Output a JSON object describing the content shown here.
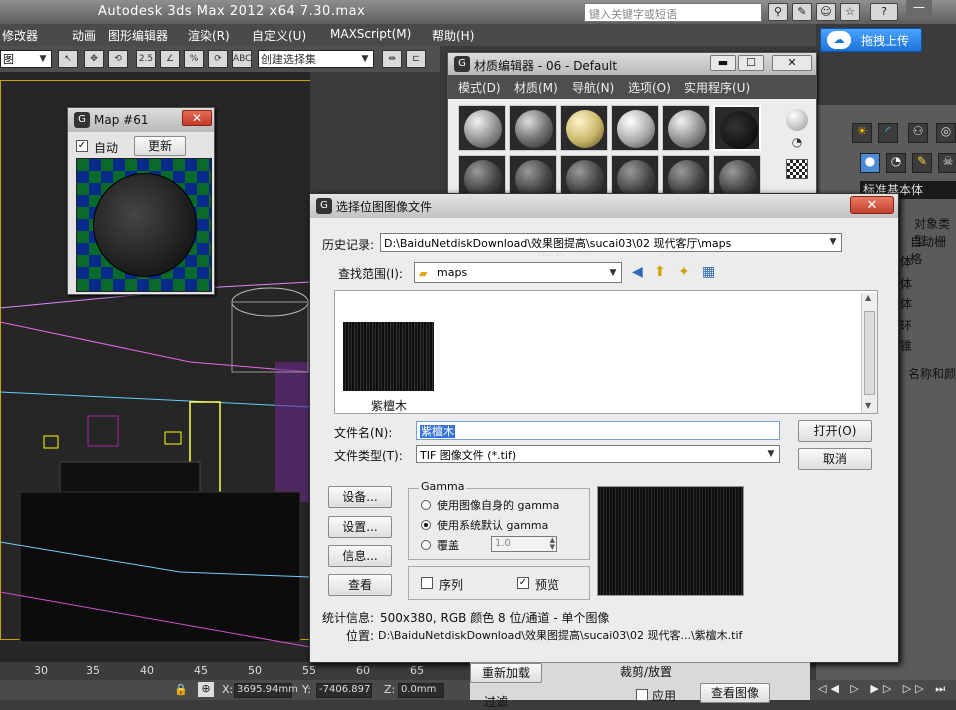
{
  "app": {
    "title": "Autodesk 3ds Max  2012 x64     7.30.max",
    "search_placeholder": "键入关键字或短语",
    "upload_label": "拖拽上传",
    "minimize": "—"
  },
  "menubar": {
    "items": [
      "修改器",
      "动画",
      "图形编辑器",
      "渲染(R)",
      "自定义(U)",
      "MAXScript(M)",
      "帮助(H)"
    ]
  },
  "toolbar": {
    "view_dropdown": "图",
    "selection_set": "创建选择集",
    "icons": [
      "↖",
      "✥",
      "⟲",
      "▣",
      "2.5",
      "∠",
      "%",
      "⟳",
      "ABC"
    ]
  },
  "map61": {
    "title": "Map #61",
    "auto_label": "自动",
    "auto_checked": true,
    "update_label": "更新",
    "close": "✕"
  },
  "material_editor": {
    "title": "材质编辑器 - 06 - Default",
    "menus": [
      "模式(D)",
      "材质(M)",
      "导航(N)",
      "选项(O)",
      "实用程序(U)"
    ],
    "min": "▬",
    "max": "☐",
    "close": "✕"
  },
  "dialog": {
    "title": "选择位图图像文件",
    "close": "✕",
    "history_label": "历史记录:",
    "history_value": "D:\\BaiduNetdiskDownload\\效果图提高\\sucai03\\02 现代客厅\\maps",
    "lookin_label": "查找范围(I):",
    "lookin_value": "maps",
    "files": [
      {
        "name": "紫檀木"
      }
    ],
    "filename_label": "文件名(N):",
    "filename_value": "紫檀木",
    "filetype_label": "文件类型(T):",
    "filetype_value": "TIF 图像文件 (*.tif)",
    "open_button": "打开(O)",
    "cancel_button": "取消",
    "setup_button": "设备...",
    "settings_button": "设置...",
    "info_button": "信息...",
    "view_button": "查看",
    "gamma": {
      "title": "Gamma",
      "opt1": "使用图像自身的 gamma",
      "opt2": "使用系统默认 gamma",
      "opt3": "覆盖",
      "override_value": "1.0",
      "selected": 2
    },
    "sequence_label": "序列",
    "preview_label": "预览",
    "sequence_checked": false,
    "preview_checked": true,
    "stats_label": "统计信息:",
    "stats_value": "500x380, RGB 颜色 8 位/通道 - 单个图像",
    "location_label": "位置:",
    "location_value": "D:\\BaiduNetdiskDownload\\效果图提高\\sucai03\\02 现代客...\\紫檀木.tif"
  },
  "command_panel": {
    "std_primitives": "标准基本体",
    "object_type": "对象类型",
    "auto_grid": "自动栅格",
    "name_color": "名称和颜",
    "rows": [
      "体",
      "体",
      "体",
      "环",
      "锥"
    ]
  },
  "bottom_panel": {
    "reload": "重新加载",
    "crop_title": "裁剪/放置",
    "apply": "应用",
    "view_image": "查看图像",
    "filter": "过滤"
  },
  "ruler": {
    "ticks": [
      "30",
      "35",
      "40",
      "45",
      "50",
      "55",
      "60",
      "65"
    ]
  },
  "status": {
    "x_label": "X:",
    "x_value": "3695.94mm",
    "y_label": "Y:",
    "y_value": "-7406.897",
    "z_label": "Z:",
    "z_value": "0.0mm"
  },
  "colors": {
    "accent": "#1e73d8",
    "close_red": "#c33a27",
    "viewport_bg": "#262626"
  }
}
